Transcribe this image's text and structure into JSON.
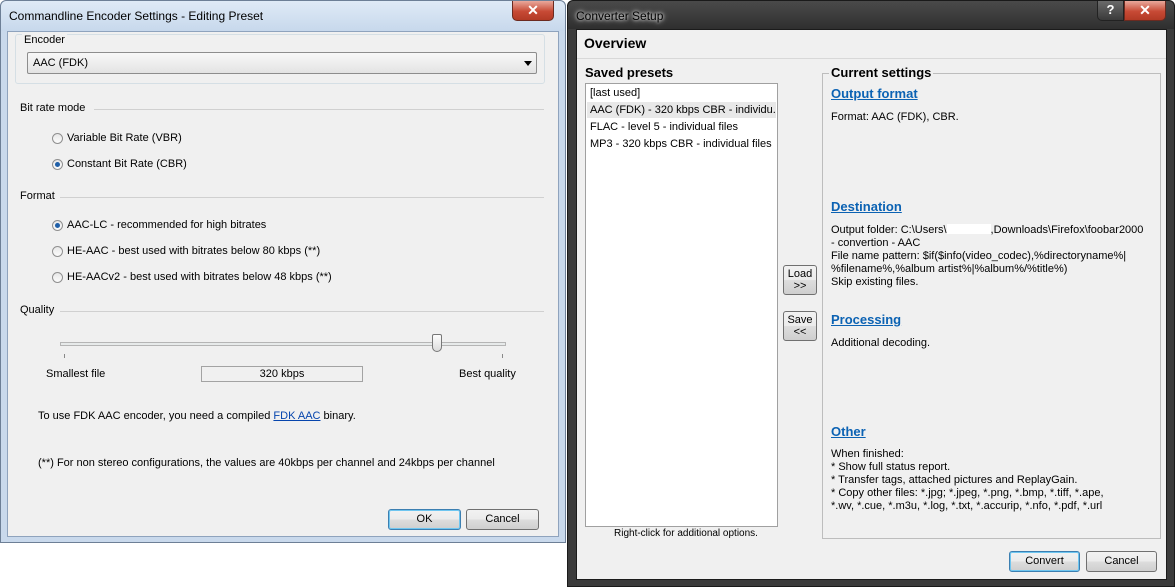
{
  "encoder_window": {
    "title": "Commandline Encoder Settings - Editing Preset",
    "close_glyph": "✕",
    "encoder_group": "Encoder",
    "encoder_value": "AAC (FDK)",
    "bitrate_mode_label": "Bit rate mode",
    "bitrate_modes": [
      {
        "label": "Variable Bit Rate (VBR)",
        "selected": false
      },
      {
        "label": "Constant Bit Rate (CBR)",
        "selected": true
      }
    ],
    "format_label": "Format",
    "formats": [
      {
        "label": "AAC-LC - recommended for high bitrates",
        "selected": true
      },
      {
        "label": "HE-AAC - best used with bitrates below 80 kbps (**)",
        "selected": false
      },
      {
        "label": "HE-AACv2 - best used with bitrates below 48 kbps (**)",
        "selected": false
      }
    ],
    "quality_label": "Quality",
    "quality_level": 0.85,
    "smallest_file": "Smallest file",
    "quality_value": "320 kbps",
    "best_quality": "Best quality",
    "fdk_note_prefix": "To use FDK AAC encoder, you need a compiled ",
    "fdk_link": "FDK AAC",
    "fdk_note_suffix": " binary.",
    "stereo_note": "(**) For non stereo configurations, the values are 40kbps per channel and 24kbps per channel",
    "ok_label": "OK",
    "cancel_label": "Cancel"
  },
  "converter_window": {
    "title": "Converter Setup",
    "help_glyph": "?",
    "close_glyph": "✕",
    "overview": "Overview",
    "saved_presets_label": "Saved presets",
    "presets": [
      "[last used]",
      "AAC (FDK) - 320 kbps CBR - individu...",
      "FLAC - level 5 - individual files",
      "MP3 - 320 kbps CBR - individual files"
    ],
    "presets_hint": "Right-click for additional options.",
    "load_label": "Load",
    "load_arrow": ">>",
    "save_label": "Save",
    "save_arrow": "<<",
    "current_settings_label": "Current settings",
    "sections": {
      "output_format": {
        "heading": "Output format",
        "text": "Format: AAC (FDK), CBR."
      },
      "destination": {
        "heading": "Destination",
        "folder_prefix": "Output folder: C:\\Users\\",
        "folder_suffix": ",Downloads\\Firefox\\foobar2000",
        "folder_line2": "- convertion - AAC",
        "pattern_line1": "File name pattern: $if($info(video_codec),%directoryname%|",
        "pattern_line2": "%filename%,%album artist%|%album%/%title%)",
        "skip": "Skip existing files."
      },
      "processing": {
        "heading": "Processing",
        "text": "Additional decoding."
      },
      "other": {
        "heading": "Other",
        "text": "When finished:\n* Show full status report.\n* Transfer tags, attached pictures and ReplayGain.\n* Copy other files: *.jpg; *.jpeg, *.png, *.bmp, *.tiff, *.ape,\n*.wv, *.cue, *.m3u, *.log, *.txt, *.accurip, *.nfo, *.pdf, *.url"
      }
    },
    "convert_label": "Convert",
    "cancel_label": "Cancel"
  }
}
